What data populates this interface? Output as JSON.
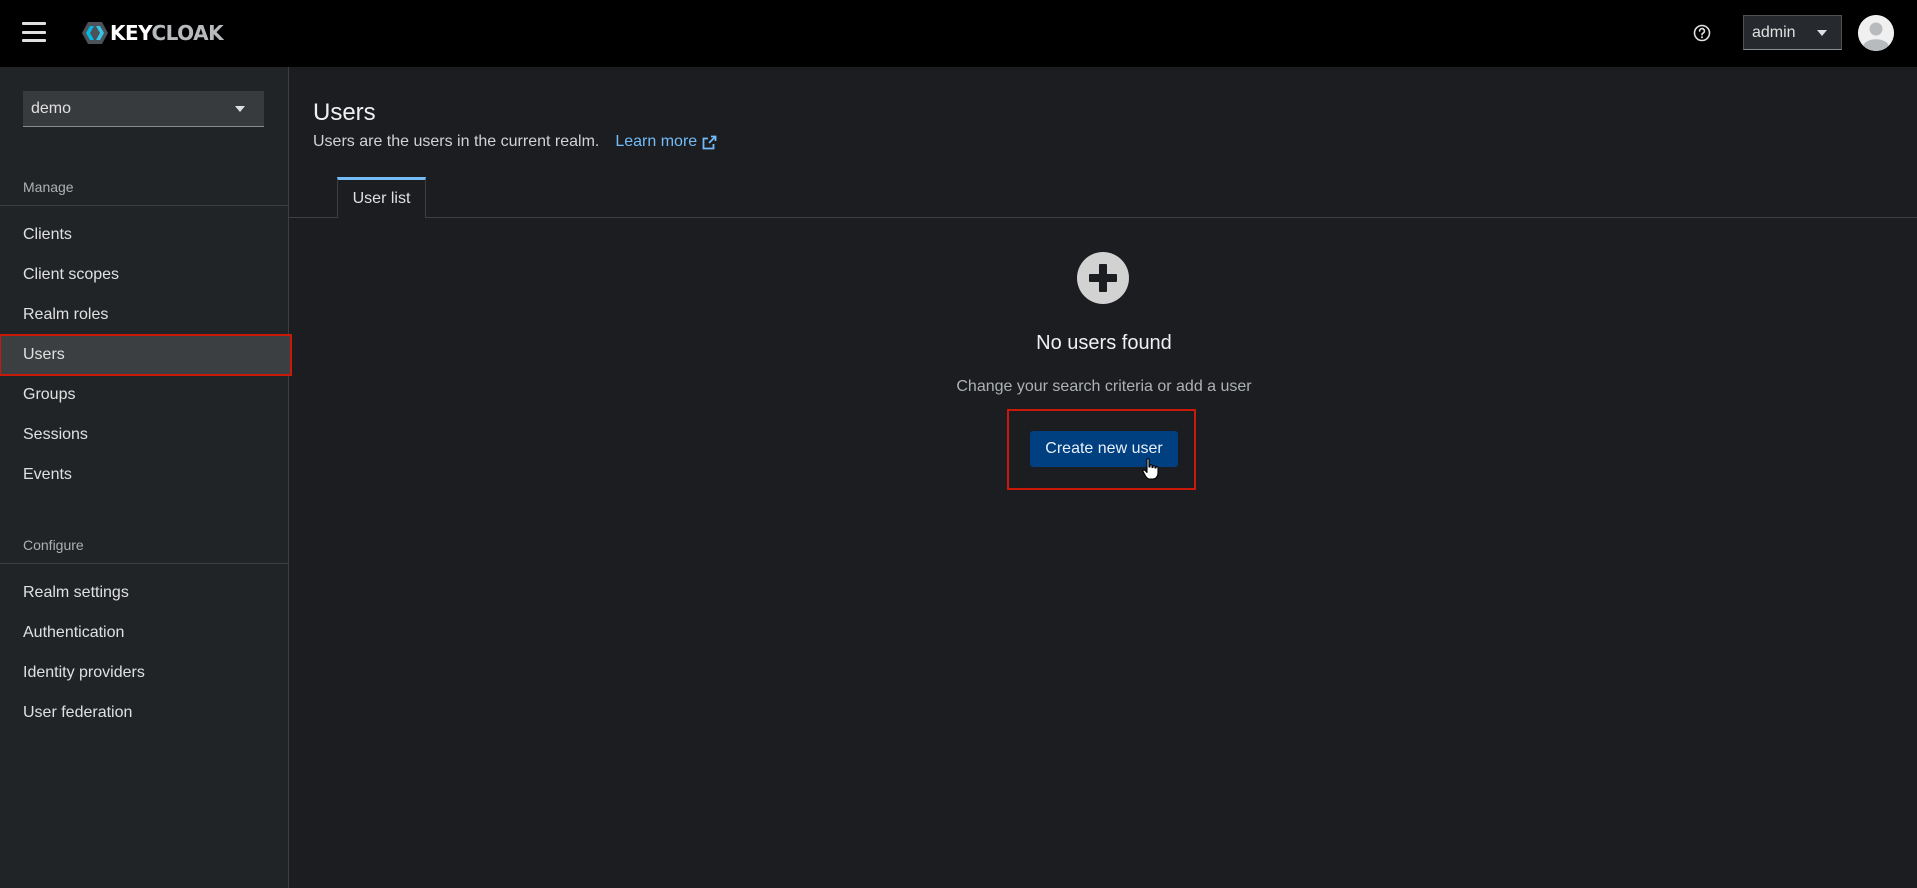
{
  "header": {
    "brand_primary": "KEY",
    "brand_secondary": "CLOAK",
    "menu_icon": "hamburger-icon",
    "help_icon": "help-circle-icon",
    "user_label": "admin",
    "avatar_icon": "user-avatar-icon"
  },
  "sidebar": {
    "realm": "demo",
    "manage_title": "Manage",
    "manage_items": [
      {
        "label": "Clients"
      },
      {
        "label": "Client scopes"
      },
      {
        "label": "Realm roles"
      },
      {
        "label": "Users",
        "active": true
      },
      {
        "label": "Groups"
      },
      {
        "label": "Sessions"
      },
      {
        "label": "Events"
      }
    ],
    "configure_title": "Configure",
    "configure_items": [
      {
        "label": "Realm settings"
      },
      {
        "label": "Authentication"
      },
      {
        "label": "Identity providers"
      },
      {
        "label": "User federation"
      }
    ]
  },
  "main": {
    "title": "Users",
    "description": "Users are the users in the current realm.",
    "learn_more": "Learn more",
    "tabs": [
      {
        "label": "User list",
        "active": true
      }
    ],
    "empty_state": {
      "icon": "plus-circle-icon",
      "title": "No users found",
      "subtitle": "Change your search criteria or add a user",
      "button": "Create new user"
    }
  },
  "colors": {
    "masthead": "#000000",
    "background": "#1b1d21",
    "sidebar": "#212427",
    "primary_button": "#004080",
    "link": "#73bcf7",
    "highlight": "#c9190b"
  }
}
